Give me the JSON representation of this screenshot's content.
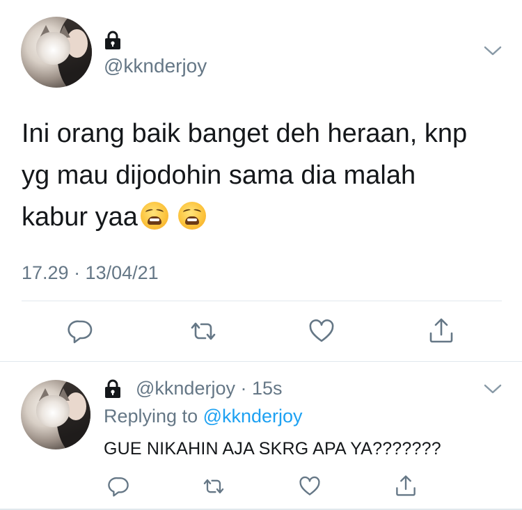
{
  "main_tweet": {
    "handle": "@kknderjoy",
    "text_line1": "Ini orang baik banget deh heraan, knp",
    "text_line2": "yg mau dijodohin sama dia malah",
    "text_line3": "kabur yaa",
    "emojis": [
      "weary-face-emoji",
      "weary-face-emoji"
    ],
    "timestamp": "17.29 · 13/04/21",
    "actions": [
      "reply",
      "retweet",
      "like",
      "share"
    ]
  },
  "reply_tweet": {
    "handle": "@kknderjoy",
    "separator": "·",
    "time": "15s",
    "replying_prefix": "Replying to ",
    "replying_mention": "@kknderjoy",
    "text": "GUE NIKAHIN AJA SKRG APA YA???????",
    "actions": [
      "reply",
      "retweet",
      "like",
      "share"
    ]
  },
  "colors": {
    "text": "#14171a",
    "secondary": "#657786",
    "link": "#1da1f2",
    "divider": "#e1e8ed"
  }
}
